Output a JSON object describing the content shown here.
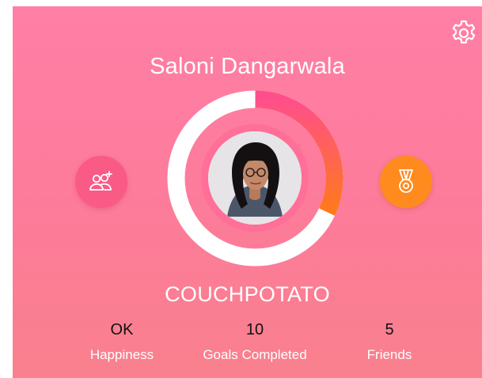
{
  "profile": {
    "name": "Saloni Dangarwala",
    "level": "COUCHPOTATO",
    "progress": 0.32
  },
  "stats": [
    {
      "value": "OK",
      "label": "Happiness"
    },
    {
      "value": "10",
      "label": "Goals Completed"
    },
    {
      "value": "5",
      "label": "Friends"
    }
  ],
  "icons": {
    "settings": "gear-icon",
    "friends": "add-friends-icon",
    "achievements": "medal-icon"
  },
  "colors": {
    "background_top": "#ff7fa6",
    "background_bottom": "#f9808d",
    "progress_start": "#ff4f8b",
    "progress_end": "#ff7a1a",
    "ring_track": "#ffffff",
    "friends_button": "#f95a86",
    "medal_button": "#ff8b1f"
  }
}
